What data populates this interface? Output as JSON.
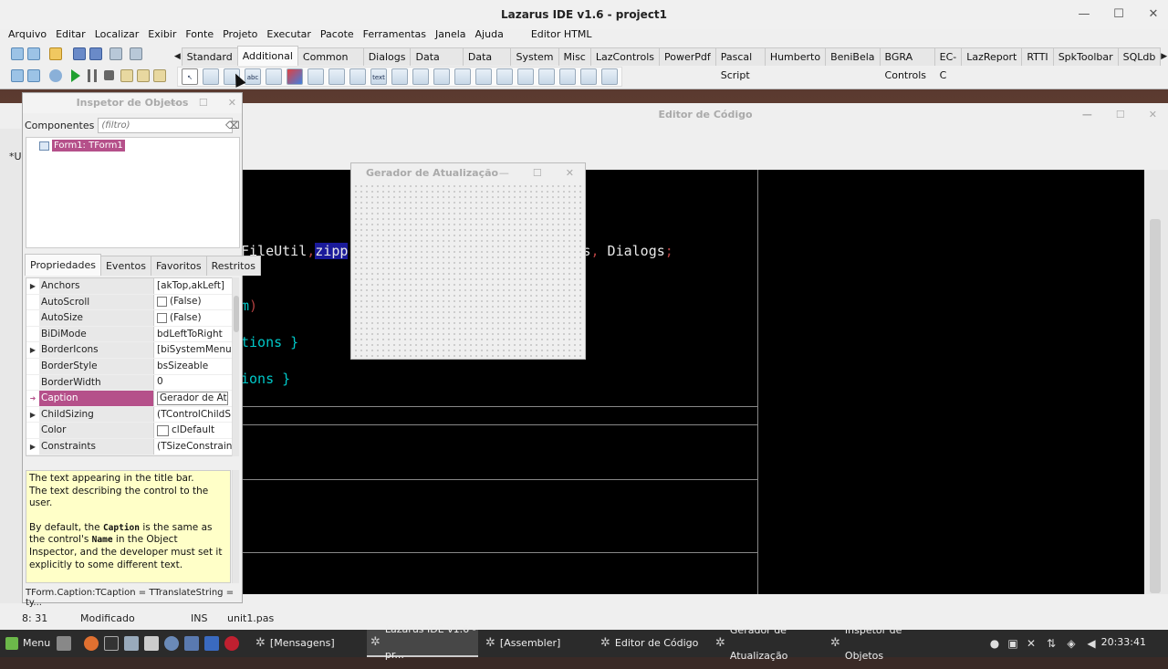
{
  "main": {
    "title": "Lazarus IDE v1.6 - project1",
    "menu": [
      "Arquivo",
      "Editar",
      "Localizar",
      "Exibir",
      "Fonte",
      "Projeto",
      "Executar",
      "Pacote",
      "Ferramentas",
      "Janela",
      "Ajuda"
    ],
    "menu_extra": "Editor HTML",
    "palette_tabs": [
      "Standard",
      "Additional",
      "Common Controls",
      "Dialogs",
      "Data Controls",
      "Data Access",
      "System",
      "Misc",
      "LazControls",
      "PowerPdf",
      "Pascal Script",
      "Humberto",
      "BeniBela",
      "BGRA Controls",
      "EC-C",
      "LazReport",
      "RTTI",
      "SpkToolbar",
      "SQLdb"
    ],
    "active_palette": "Additional",
    "component_icon_text": [
      "abc",
      "text",
      "abc"
    ]
  },
  "inspector": {
    "title": "Inspetor de Objetos",
    "components_label": "Componentes",
    "filter_placeholder": "(filtro)",
    "tree_item": "Form1: TForm1",
    "tabs": [
      "Propriedades",
      "Eventos",
      "Favoritos",
      "Restritos"
    ],
    "properties": [
      {
        "name": "Anchors",
        "value": "[akTop,akLeft]",
        "expand": true
      },
      {
        "name": "AutoScroll",
        "value": "(False)",
        "check": true
      },
      {
        "name": "AutoSize",
        "value": "(False)",
        "check": true
      },
      {
        "name": "BiDiMode",
        "value": "bdLeftToRight"
      },
      {
        "name": "BorderIcons",
        "value": "[biSystemMenu,bi",
        "expand": true
      },
      {
        "name": "BorderStyle",
        "value": "bsSizeable"
      },
      {
        "name": "BorderWidth",
        "value": "0"
      },
      {
        "name": "Caption",
        "value": "Gerador de Atua",
        "selected": true
      },
      {
        "name": "ChildSizing",
        "value": "(TControlChildSizi",
        "expand": true
      },
      {
        "name": "Color",
        "value": "clDefault",
        "swatch": true
      },
      {
        "name": "Constraints",
        "value": "(TSizeConstraints",
        "expand": true
      }
    ],
    "help_line1": "The text appearing in the title bar.",
    "help_line2": "The text describing the control to the user.",
    "help_p2_a": "By default, the ",
    "help_caption": "Caption",
    "help_p2_b": " is the same as the control's ",
    "help_name": "Name",
    "help_p2_c": " in the Object Inspector, and the developer must set it explicitly to some different text.",
    "hint": "TForm.Caption:TCaption = TTranslateString = ty..."
  },
  "editor": {
    "title": "Editor de Código",
    "side_tab": "*U",
    "lines": [
      {
        "text": "FileUtil",
        "color": "#e8e8e8"
      },
      {
        "text": ",",
        "color": "#b04040"
      },
      {
        "text": "zipp",
        "color": "#e8e8e8",
        "highlight": true
      },
      {
        "text": "ics",
        "color": "#e8e8e8"
      },
      {
        "text": ",",
        "color": "#b04040"
      },
      {
        "text": " Dialogs",
        "color": "#e8e8e8"
      },
      {
        "text": ";",
        "color": "#b04040"
      }
    ],
    "line_m": "m",
    "line_paren": ")",
    "line_tions": "tions }",
    "line_ions": "ions }",
    "status_pos": "8: 31",
    "status_mod": "Modificado",
    "status_ins": "INS",
    "status_file": "unit1.pas"
  },
  "form": {
    "title": "Gerador de Atualização"
  },
  "taskbar": {
    "menu_label": "Menu",
    "items": [
      "[Mensagens]",
      "Lazarus IDE v1.6 - pr...",
      "[Assembler]",
      "Editor de Código",
      "Gerador de Atualização",
      "Inspetor de Objetos"
    ],
    "clock": "20:33:41"
  }
}
